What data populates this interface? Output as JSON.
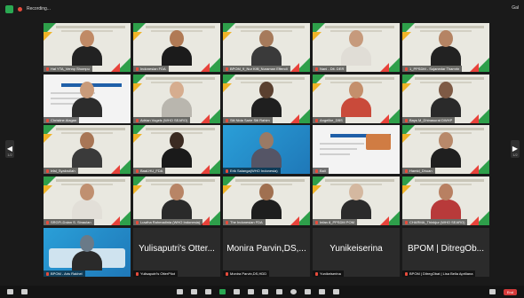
{
  "topbar": {
    "recording_label": "Recording...",
    "view_label": "Gal"
  },
  "tiles": [
    {
      "name": "Hal YTA_Venny Shompu",
      "type": "video",
      "skin": "#c08a66",
      "shirt": "#222"
    },
    {
      "name": "Indonesian FDA",
      "type": "video",
      "skin": "#b07a55",
      "shirt": "#1b1b1b"
    },
    {
      "name": "BPOM_9_Nur Kifli_Nuraman Effendi",
      "type": "video",
      "skin": "#a67a5b",
      "shirt": "#3a3a3a"
    },
    {
      "name": "Nani - Dit. DER",
      "type": "video",
      "skin": "#c69a7c",
      "shirt": "#e0ddd6"
    },
    {
      "name": "1_PPSDM - Sujanedar Thamrin",
      "type": "video",
      "skin": "#b58464",
      "shirt": "#222"
    },
    {
      "name": "Christine Alagan",
      "type": "slide",
      "skin": "#c99b7a",
      "shirt": "#2c2c2c"
    },
    {
      "name": "Adrian Vogels (WHO SEARO)",
      "type": "video",
      "skin": "#d6ad8f",
      "shirt": "#b9b6ae"
    },
    {
      "name": "Siti Nida Sarie Siti Rahim",
      "type": "video",
      "skin": "#5a4030",
      "shirt": "#1f1f1f"
    },
    {
      "name": "Angelike_DBS",
      "type": "video",
      "skin": "#c48f6c",
      "shirt": "#c94a3a"
    },
    {
      "name": "Bays M_Dhinasurat DWHP",
      "type": "video",
      "skin": "#7e5a45",
      "shirt": "#2a2a2a"
    },
    {
      "name": "Irfal_Syakrullah",
      "type": "video",
      "skin": "#a87656",
      "shirt": "#3a3a3a"
    },
    {
      "name": "Baal-HU_FDA",
      "type": "video",
      "skin": "#3b2b22",
      "shirt": "#1a1a1a"
    },
    {
      "name": "Erik Salanga(WHO Indonesia)",
      "type": "blue",
      "skin": "#9a7a65",
      "shirt": "#556"
    },
    {
      "name": "Bali",
      "type": "slide",
      "skin": "#c99b7a",
      "shirt": "#2c2c2c"
    },
    {
      "name": "Hamid_Dhuan",
      "type": "video",
      "skin": "#b8896a",
      "shirt": "#1f1f1f"
    },
    {
      "name": "SRGFI-Dolan S. Sinaulan",
      "type": "video",
      "skin": "#c09070",
      "shirt": "#e2dfd8"
    },
    {
      "name": "Luwiha Rahmadinia (WHO Indonesia)",
      "type": "video",
      "skin": "#b88566",
      "shirt": "#2a2a2a"
    },
    {
      "name": "The Indonesian FDA",
      "type": "video",
      "skin": "#a07050",
      "shirt": "#1e1e1e"
    },
    {
      "name": "Infan 8_PPSDM POM",
      "type": "video",
      "skin": "#d4b8a0",
      "shirt": "#2b2b2b"
    },
    {
      "name": "CHARMA_Thinkjur (WHO SEARO)",
      "type": "video",
      "skin": "#b88062",
      "shirt": "#b83a3a"
    },
    {
      "name": "BPOM - Aris Rakhel",
      "type": "map",
      "skin": "#6a7a88",
      "shirt": "#2a2a2a"
    },
    {
      "name": "Yulisaputri's OtterPilot",
      "type": "dark",
      "big": "Yulisaputri's Otter..."
    },
    {
      "name": "Monira Parvin,DS,HDD",
      "type": "dark",
      "big": "Monira Parvin,DS,..."
    },
    {
      "name": "Yunikeiserina",
      "type": "dark",
      "big": "Yunikeiserina"
    },
    {
      "name": "BPOM | DitregObat | Lisa Bella Apriliana",
      "type": "dark",
      "big": "BPOM | DitregOb..."
    }
  ],
  "pagination": {
    "left": "1/2",
    "right": "1/2"
  },
  "toolbar": {
    "items": [
      {
        "label": "Mute",
        "icon": "mic-icon"
      },
      {
        "label": "Start Video",
        "icon": "video-icon"
      },
      {
        "label": "Security",
        "icon": "shield-icon"
      },
      {
        "label": "Participants",
        "icon": "participants-icon"
      },
      {
        "label": "Chat",
        "icon": "chat-icon"
      },
      {
        "label": "Share",
        "icon": "share-screen-icon"
      },
      {
        "label": "Summary",
        "icon": "summary-icon"
      },
      {
        "label": "AI Companion",
        "icon": "sparkle-icon"
      },
      {
        "label": "Record",
        "icon": "record-icon"
      },
      {
        "label": "Show Captions",
        "icon": "captions-icon"
      },
      {
        "label": "Reactions",
        "icon": "reactions-icon"
      },
      {
        "label": "Apps",
        "icon": "apps-icon"
      },
      {
        "label": "Whiteboards",
        "icon": "whiteboard-icon"
      },
      {
        "label": "Notes",
        "icon": "notes-icon"
      },
      {
        "label": "More",
        "icon": "more-icon"
      }
    ],
    "end_label": "End"
  },
  "colors": {
    "accent_green": "#2e9f4a",
    "accent_yellow": "#f0b428",
    "accent_red": "#e8423a",
    "end_red": "#d63b3b"
  }
}
